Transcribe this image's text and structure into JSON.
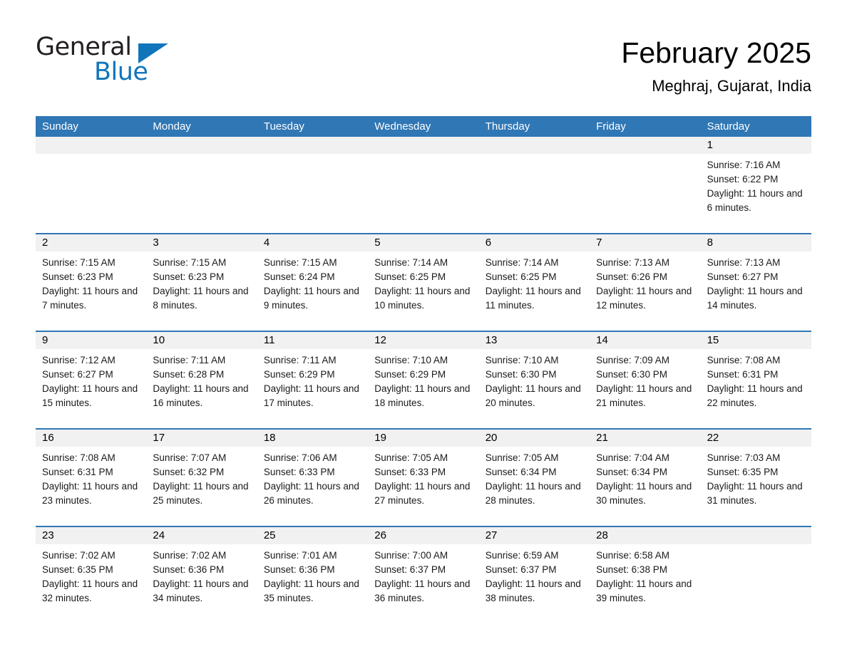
{
  "brand": {
    "name_part1": "General",
    "name_part2": "Blue",
    "triangle_icon": "triangle-icon",
    "accent_color": "#1175bb"
  },
  "header": {
    "title": "February 2025",
    "subtitle": "Meghraj, Gujarat, India"
  },
  "calendar": {
    "header_color": "#3077b5",
    "daynum_bg": "#f1f1f1",
    "weekdays": [
      "Sunday",
      "Monday",
      "Tuesday",
      "Wednesday",
      "Thursday",
      "Friday",
      "Saturday"
    ],
    "weeks": [
      [
        {
          "empty": true
        },
        {
          "empty": true
        },
        {
          "empty": true
        },
        {
          "empty": true
        },
        {
          "empty": true
        },
        {
          "empty": true
        },
        {
          "day": "1",
          "sunrise": "Sunrise: 7:16 AM",
          "sunset": "Sunset: 6:22 PM",
          "daylight": "Daylight: 11 hours and 6 minutes."
        }
      ],
      [
        {
          "day": "2",
          "sunrise": "Sunrise: 7:15 AM",
          "sunset": "Sunset: 6:23 PM",
          "daylight": "Daylight: 11 hours and 7 minutes."
        },
        {
          "day": "3",
          "sunrise": "Sunrise: 7:15 AM",
          "sunset": "Sunset: 6:23 PM",
          "daylight": "Daylight: 11 hours and 8 minutes."
        },
        {
          "day": "4",
          "sunrise": "Sunrise: 7:15 AM",
          "sunset": "Sunset: 6:24 PM",
          "daylight": "Daylight: 11 hours and 9 minutes."
        },
        {
          "day": "5",
          "sunrise": "Sunrise: 7:14 AM",
          "sunset": "Sunset: 6:25 PM",
          "daylight": "Daylight: 11 hours and 10 minutes."
        },
        {
          "day": "6",
          "sunrise": "Sunrise: 7:14 AM",
          "sunset": "Sunset: 6:25 PM",
          "daylight": "Daylight: 11 hours and 11 minutes."
        },
        {
          "day": "7",
          "sunrise": "Sunrise: 7:13 AM",
          "sunset": "Sunset: 6:26 PM",
          "daylight": "Daylight: 11 hours and 12 minutes."
        },
        {
          "day": "8",
          "sunrise": "Sunrise: 7:13 AM",
          "sunset": "Sunset: 6:27 PM",
          "daylight": "Daylight: 11 hours and 14 minutes."
        }
      ],
      [
        {
          "day": "9",
          "sunrise": "Sunrise: 7:12 AM",
          "sunset": "Sunset: 6:27 PM",
          "daylight": "Daylight: 11 hours and 15 minutes."
        },
        {
          "day": "10",
          "sunrise": "Sunrise: 7:11 AM",
          "sunset": "Sunset: 6:28 PM",
          "daylight": "Daylight: 11 hours and 16 minutes."
        },
        {
          "day": "11",
          "sunrise": "Sunrise: 7:11 AM",
          "sunset": "Sunset: 6:29 PM",
          "daylight": "Daylight: 11 hours and 17 minutes."
        },
        {
          "day": "12",
          "sunrise": "Sunrise: 7:10 AM",
          "sunset": "Sunset: 6:29 PM",
          "daylight": "Daylight: 11 hours and 18 minutes."
        },
        {
          "day": "13",
          "sunrise": "Sunrise: 7:10 AM",
          "sunset": "Sunset: 6:30 PM",
          "daylight": "Daylight: 11 hours and 20 minutes."
        },
        {
          "day": "14",
          "sunrise": "Sunrise: 7:09 AM",
          "sunset": "Sunset: 6:30 PM",
          "daylight": "Daylight: 11 hours and 21 minutes."
        },
        {
          "day": "15",
          "sunrise": "Sunrise: 7:08 AM",
          "sunset": "Sunset: 6:31 PM",
          "daylight": "Daylight: 11 hours and 22 minutes."
        }
      ],
      [
        {
          "day": "16",
          "sunrise": "Sunrise: 7:08 AM",
          "sunset": "Sunset: 6:31 PM",
          "daylight": "Daylight: 11 hours and 23 minutes."
        },
        {
          "day": "17",
          "sunrise": "Sunrise: 7:07 AM",
          "sunset": "Sunset: 6:32 PM",
          "daylight": "Daylight: 11 hours and 25 minutes."
        },
        {
          "day": "18",
          "sunrise": "Sunrise: 7:06 AM",
          "sunset": "Sunset: 6:33 PM",
          "daylight": "Daylight: 11 hours and 26 minutes."
        },
        {
          "day": "19",
          "sunrise": "Sunrise: 7:05 AM",
          "sunset": "Sunset: 6:33 PM",
          "daylight": "Daylight: 11 hours and 27 minutes."
        },
        {
          "day": "20",
          "sunrise": "Sunrise: 7:05 AM",
          "sunset": "Sunset: 6:34 PM",
          "daylight": "Daylight: 11 hours and 28 minutes."
        },
        {
          "day": "21",
          "sunrise": "Sunrise: 7:04 AM",
          "sunset": "Sunset: 6:34 PM",
          "daylight": "Daylight: 11 hours and 30 minutes."
        },
        {
          "day": "22",
          "sunrise": "Sunrise: 7:03 AM",
          "sunset": "Sunset: 6:35 PM",
          "daylight": "Daylight: 11 hours and 31 minutes."
        }
      ],
      [
        {
          "day": "23",
          "sunrise": "Sunrise: 7:02 AM",
          "sunset": "Sunset: 6:35 PM",
          "daylight": "Daylight: 11 hours and 32 minutes."
        },
        {
          "day": "24",
          "sunrise": "Sunrise: 7:02 AM",
          "sunset": "Sunset: 6:36 PM",
          "daylight": "Daylight: 11 hours and 34 minutes."
        },
        {
          "day": "25",
          "sunrise": "Sunrise: 7:01 AM",
          "sunset": "Sunset: 6:36 PM",
          "daylight": "Daylight: 11 hours and 35 minutes."
        },
        {
          "day": "26",
          "sunrise": "Sunrise: 7:00 AM",
          "sunset": "Sunset: 6:37 PM",
          "daylight": "Daylight: 11 hours and 36 minutes."
        },
        {
          "day": "27",
          "sunrise": "Sunrise: 6:59 AM",
          "sunset": "Sunset: 6:37 PM",
          "daylight": "Daylight: 11 hours and 38 minutes."
        },
        {
          "day": "28",
          "sunrise": "Sunrise: 6:58 AM",
          "sunset": "Sunset: 6:38 PM",
          "daylight": "Daylight: 11 hours and 39 minutes."
        },
        {
          "empty": true
        }
      ]
    ]
  }
}
